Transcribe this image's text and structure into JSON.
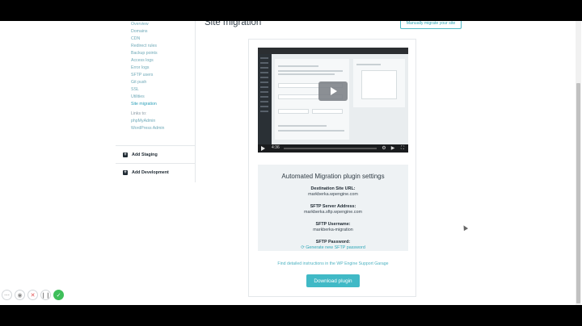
{
  "page": {
    "title": "Site migration",
    "manual_button": "Manually migrate your site"
  },
  "sidebar": {
    "items": [
      "Overview",
      "Domains",
      "CDN",
      "Redirect rules",
      "Backup points",
      "Access logs",
      "Error logs",
      "SFTP users",
      "Git push",
      "SSL",
      "Utilities",
      "Site migration"
    ],
    "active": "Site migration",
    "links_header": "Links to:",
    "links": [
      "phpMyAdmin",
      "WordPress Admin"
    ],
    "environments": [
      "Add Staging",
      "Add Development"
    ]
  },
  "video": {
    "time": "4:36",
    "icons": [
      "play-icon",
      "settings-icon",
      "youtube-icon",
      "fullscreen-icon"
    ]
  },
  "settings": {
    "title": "Automated Migration plugin settings",
    "fields": [
      {
        "key": "Destination Site URL:",
        "value": "markberka.wpengine.com"
      },
      {
        "key": "SFTP Server Address:",
        "value": "markberka.sftp.wpengine.com"
      },
      {
        "key": "SFTP Username:",
        "value": "markberka-migration"
      },
      {
        "key": "SFTP Password:",
        "value": "Generate new SFTP password"
      }
    ]
  },
  "instructions_link": "Find detailed instructions in the WP Engine Support Garage",
  "download_button": "Download plugin",
  "colors": {
    "accent": "#40b9c6",
    "link": "#2ea7b7",
    "panel": "#eef2f4"
  }
}
